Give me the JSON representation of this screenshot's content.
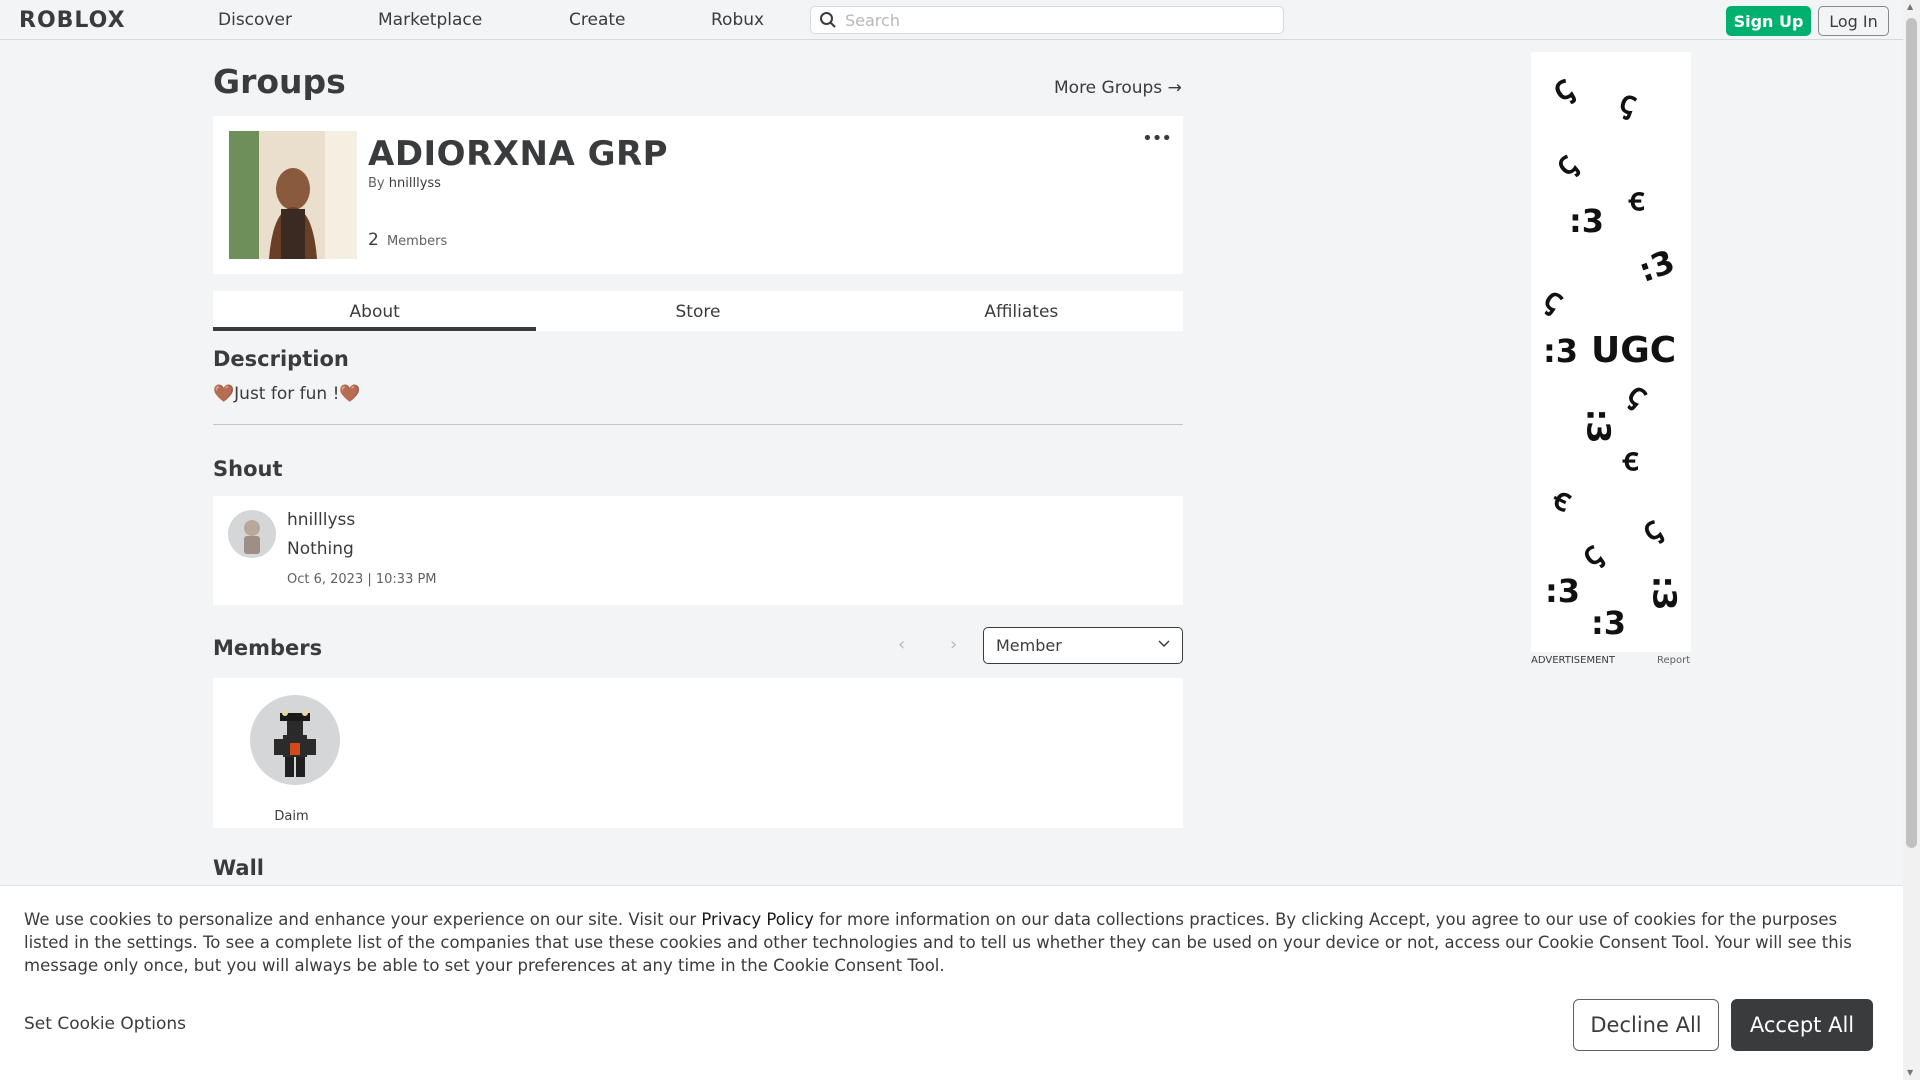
{
  "nav": {
    "logo": "ROBLOX",
    "links": [
      "Discover",
      "Marketplace",
      "Create",
      "Robux"
    ],
    "search_placeholder": "Search",
    "signup": "Sign Up",
    "login": "Log In"
  },
  "page": {
    "title": "Groups",
    "more_groups": "More Groups →"
  },
  "group": {
    "name": "ADIORXNA GRP",
    "by_label": "By",
    "owner": "hnilllyss",
    "member_count": "2",
    "members_label": "Members",
    "menu": "•••"
  },
  "tabs": [
    "About",
    "Store",
    "Affiliates"
  ],
  "description": {
    "title": "Description",
    "text": "🤎Just for fun !🤎"
  },
  "shout": {
    "title": "Shout",
    "user": "hnilllyss",
    "body": "Nothing",
    "date": "Oct 6, 2023 | 10:33 PM"
  },
  "members": {
    "title": "Members",
    "prev": "‹",
    "next": "›",
    "role": "Member",
    "list": [
      {
        "name": "Daim"
      }
    ]
  },
  "wall": {
    "title": "Wall"
  },
  "ad": {
    "label": "ADVERTISEMENT",
    "report": "Report",
    "text": "UGC"
  },
  "cookie": {
    "text_before": "We use cookies to personalize and enhance your experience on our site. Visit our ",
    "policy_link": "Privacy Policy",
    "text_after": " for more information on our data collections practices. By clicking Accept, you agree to our use of cookies for the purposes listed in the settings. To see a complete list of the companies that use these cookies and other technologies and to tell us whether they can be used on your device or not, access our Cookie Consent Tool. Your will see this message only once, but you will always be able to set your preferences at any time in the Cookie Consent Tool.",
    "options": "Set Cookie Options",
    "decline": "Decline All",
    "accept": "Accept All"
  }
}
